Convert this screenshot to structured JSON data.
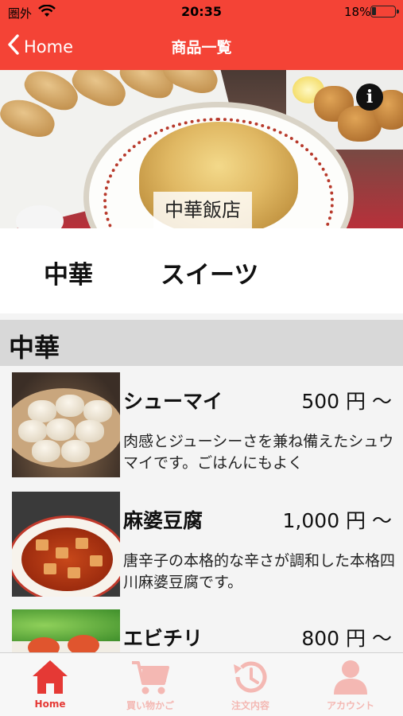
{
  "status_bar": {
    "carrier": "圏外",
    "time": "20:35",
    "battery_percent": "18%",
    "battery_level": 0.18,
    "wifi_icon": "wifi-icon"
  },
  "nav": {
    "back_label": "Home",
    "title": "商品一覧"
  },
  "hero": {
    "shop_name": "中華飯店",
    "info_icon": "info-icon",
    "info_glyph": "i"
  },
  "category_tabs": [
    {
      "label": "中華"
    },
    {
      "label": "スイーツ"
    }
  ],
  "section": {
    "title": "中華"
  },
  "products": [
    {
      "name": "シューマイ",
      "price": "500 円 〜",
      "description": "肉感とジューシーさを兼ね備えたシュウマイです。ごはんにもよく"
    },
    {
      "name": "麻婆豆腐",
      "price": "1,000 円 〜",
      "description": "唐辛子の本格的な辛さが調和した本格四川麻婆豆腐です。"
    },
    {
      "name": "エビチリ",
      "price": "800 円 〜",
      "description": ""
    }
  ],
  "tab_bar": [
    {
      "label": "Home",
      "icon": "home-icon",
      "active": true
    },
    {
      "label": "買い物かご",
      "icon": "cart-icon",
      "active": false
    },
    {
      "label": "注文内容",
      "icon": "history-icon",
      "active": false
    },
    {
      "label": "アカウント",
      "icon": "account-icon",
      "active": false
    }
  ],
  "colors": {
    "accent": "#f44336",
    "tab_active": "#e53935",
    "tab_inactive": "#f4b8b3"
  }
}
